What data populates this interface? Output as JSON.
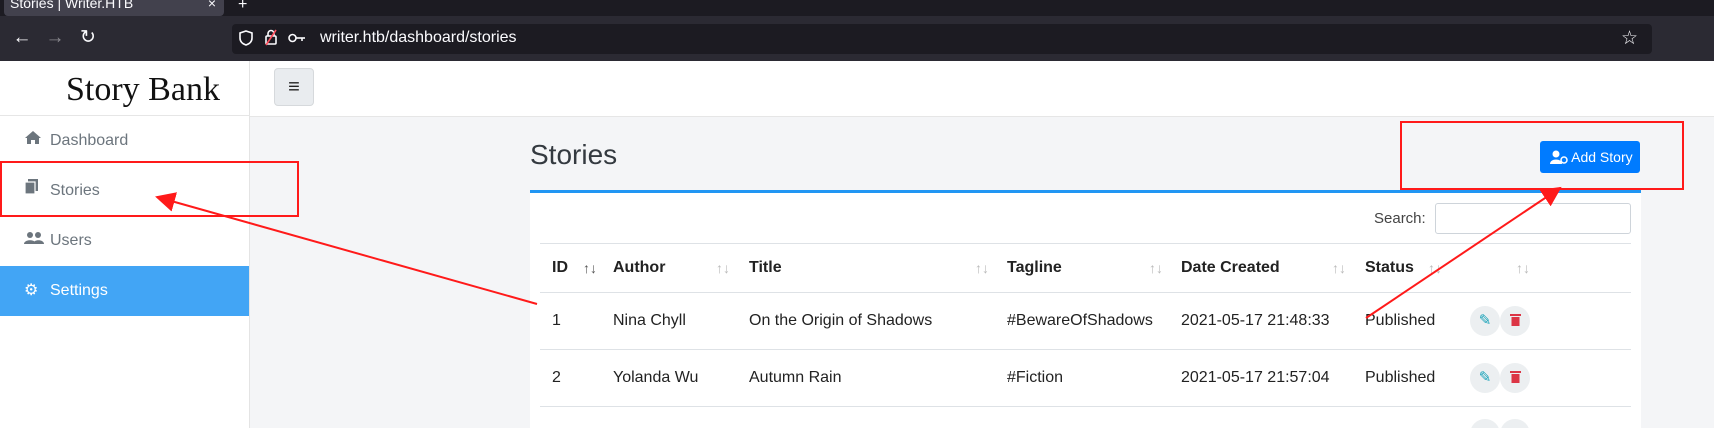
{
  "browser": {
    "tab_title": "Stories | Writer.HTB",
    "tab_close": "×",
    "new_tab": "+",
    "url": "writer.htb/dashboard/stories",
    "icons": [
      "back-icon",
      "forward-icon",
      "reload-icon",
      "shield-icon",
      "lock-icon",
      "key-icon",
      "bookmark-star-icon"
    ]
  },
  "sidebar": {
    "brand": "Story Bank",
    "items": [
      {
        "label": "Dashboard",
        "icon": "home-icon"
      },
      {
        "label": "Stories",
        "icon": "copy-icon"
      },
      {
        "label": "Users",
        "icon": "users-icon"
      },
      {
        "label": "Settings",
        "icon": "gear-icon",
        "active": true
      }
    ]
  },
  "topbar": {
    "menu_icon": "≡"
  },
  "main": {
    "title": "Stories",
    "add_button": "Add Story",
    "search_label": "Search:",
    "search_value": "",
    "columns": [
      "ID",
      "Author",
      "Title",
      "Tagline",
      "Date Created",
      "Status"
    ],
    "rows": [
      {
        "id": "1",
        "author": "Nina Chyll",
        "title": "On the Origin of Shadows",
        "tagline": "#BewareOfShadows",
        "date": "2021-05-17 21:48:33",
        "status": "Published"
      },
      {
        "id": "2",
        "author": "Yolanda Wu",
        "title": "Autumn Rain",
        "tagline": "#Fiction",
        "date": "2021-05-17 21:57:04",
        "status": "Published"
      }
    ]
  },
  "colors": {
    "accent": "#42a5f5",
    "primary_button": "#007bff",
    "annotation": "#ff1a1a",
    "edit": "#17a2b8",
    "delete": "#dc3545"
  }
}
